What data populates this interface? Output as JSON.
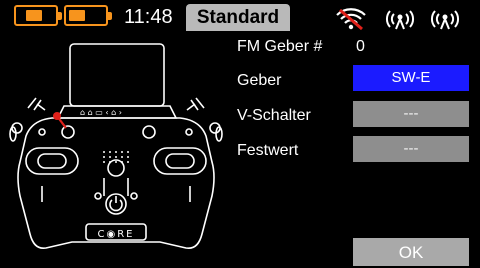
{
  "status": {
    "time": "11:48",
    "profile": "Standard"
  },
  "form": {
    "fm_geber_label": "FM Geber #",
    "fm_geber_value": "0",
    "geber_label": "Geber",
    "geber_value": "SW-E",
    "vschalter_label": "V-Schalter",
    "vschalter_value": "---",
    "festwert_label": "Festwert",
    "festwert_value": "---"
  },
  "buttons": {
    "ok": "OK"
  },
  "transmitter": {
    "brand": "CORE"
  },
  "icons": [
    "battery-icon",
    "battery-icon",
    "no-signal-icon",
    "antenna-icon",
    "antenna-icon",
    "transmitter-illustration"
  ],
  "colors": {
    "accent": "#f7941d",
    "selected": "#1b1bff",
    "field": "#8e8e8e",
    "button": "#a9a9a9"
  }
}
